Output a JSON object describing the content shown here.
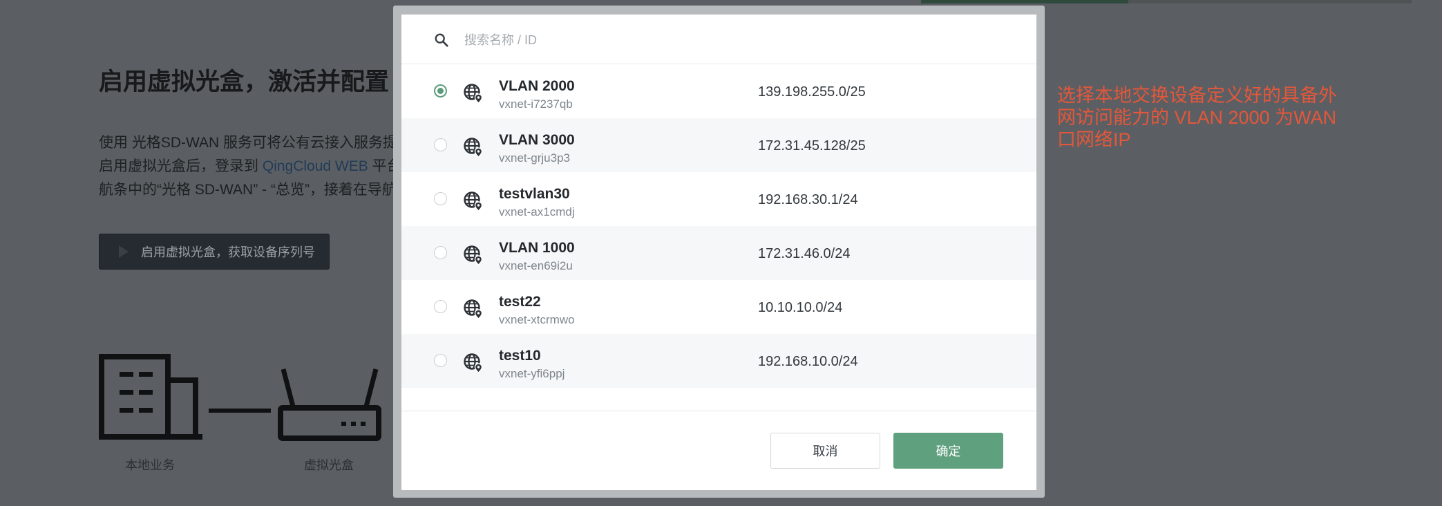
{
  "background": {
    "title": "启用虚拟光盒，激活并配置",
    "paragraph_lines": [
      "使用 光格SD-WAN 服务可将公有云接入服务提",
      "启用虚拟光盒后，登录到 ",
      "航条中的“光格 SD-WAN” - “总览”，接着在导航"
    ],
    "link_text": "QingCloud WEB",
    "line2_tail": " 平台",
    "action_button": "启用虚拟光盒，获取设备序列号",
    "diagram_labels": [
      "本地业务",
      "虚拟光盒"
    ]
  },
  "modal": {
    "search": {
      "placeholder": "搜索名称 / ID",
      "value": ""
    },
    "networks": [
      {
        "name": "VLAN 2000",
        "id": "vxnet-i7237qb",
        "cidr": "139.198.255.0/25",
        "selected": true
      },
      {
        "name": "VLAN 3000",
        "id": "vxnet-grju3p3",
        "cidr": "172.31.45.128/25",
        "selected": false
      },
      {
        "name": "testvlan30",
        "id": "vxnet-ax1cmdj",
        "cidr": "192.168.30.1/24",
        "selected": false
      },
      {
        "name": "VLAN 1000",
        "id": "vxnet-en69i2u",
        "cidr": "172.31.46.0/24",
        "selected": false
      },
      {
        "name": "test22",
        "id": "vxnet-xtcrmwo",
        "cidr": "10.10.10.0/24",
        "selected": false
      },
      {
        "name": "test10",
        "id": "vxnet-yfi6ppj",
        "cidr": "192.168.10.0/24",
        "selected": false
      }
    ],
    "cancel_label": "取消",
    "confirm_label": "确定"
  },
  "annotation": {
    "text": "选择本地交换设备定义好的具备外网访问能力的 VLAN 2000 为WAN口网络IP",
    "color": "#e4573a"
  },
  "colors": {
    "accent_green": "#5fa07f",
    "overlay": "#5b5f63"
  }
}
